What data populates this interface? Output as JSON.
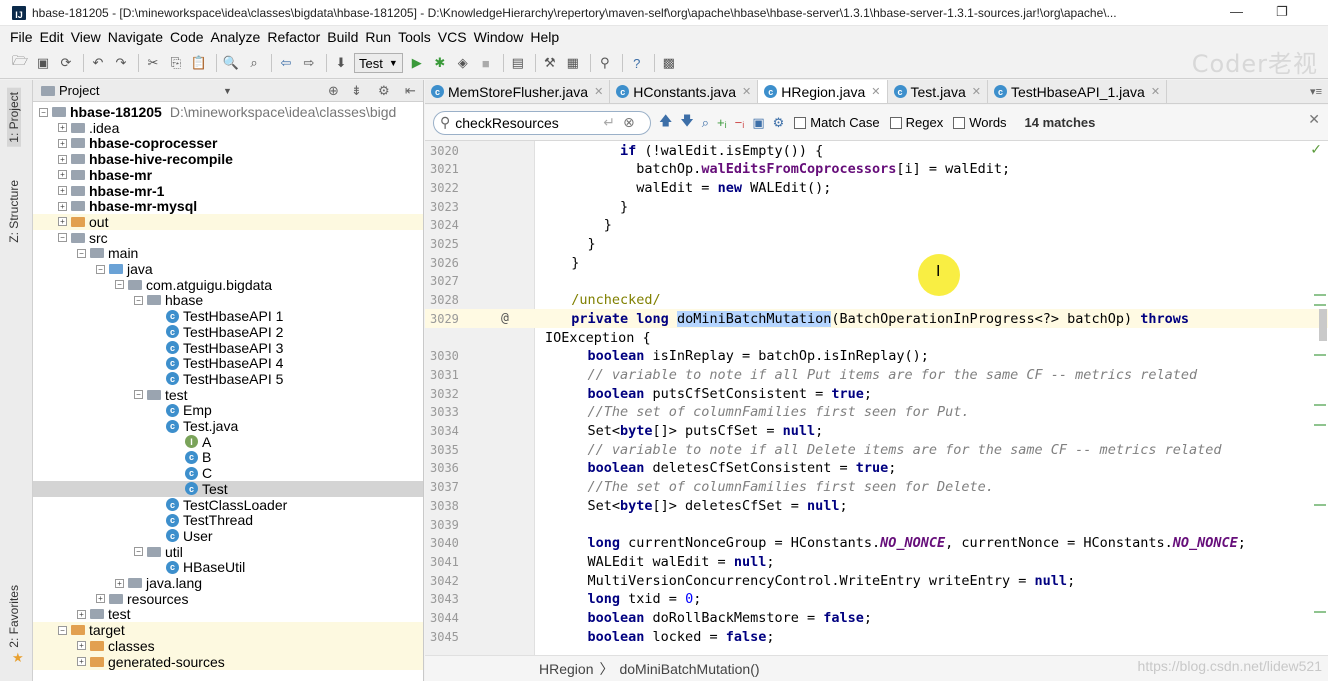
{
  "window": {
    "title": "hbase-181205 - [D:\\mineworkspace\\idea\\classes\\bigdata\\hbase-181205] - D:\\KnowledgeHierarchy\\repertory\\maven-self\\org\\apache\\hbase\\hbase-server\\1.3.1\\hbase-server-1.3.1-sources.jar!\\org\\apache\\...",
    "minimize": "—",
    "restore": "❐"
  },
  "menu": [
    "File",
    "Edit",
    "View",
    "Navigate",
    "Code",
    "Analyze",
    "Refactor",
    "Build",
    "Run",
    "Tools",
    "VCS",
    "Window",
    "Help"
  ],
  "toolbar": {
    "run_config": "Test",
    "watermark": "Coder老视"
  },
  "left_strip": {
    "project_tab": "1: Project",
    "structure_tab": "Z: Structure",
    "favorites_tab": "2: Favorites"
  },
  "project_panel": {
    "title": "Project",
    "tree": [
      {
        "label": "hbase-181205",
        "extra": "D:\\mineworkspace\\idea\\classes\\bigd",
        "indent": 0,
        "icon": "folder",
        "bold": true
      },
      {
        "label": ".idea",
        "indent": 1,
        "icon": "folder"
      },
      {
        "label": "hbase-coprocesser",
        "indent": 1,
        "icon": "folder",
        "bold": true
      },
      {
        "label": "hbase-hive-recompile",
        "indent": 1,
        "icon": "folder",
        "bold": true
      },
      {
        "label": "hbase-mr",
        "indent": 1,
        "icon": "folder",
        "bold": true
      },
      {
        "label": "hbase-mr-1",
        "indent": 1,
        "icon": "folder",
        "bold": true
      },
      {
        "label": "hbase-mr-mysql",
        "indent": 1,
        "icon": "folder",
        "bold": true
      },
      {
        "label": "out",
        "indent": 1,
        "icon": "folder-orange",
        "hl": true
      },
      {
        "label": "src",
        "indent": 1,
        "icon": "folder"
      },
      {
        "label": "main",
        "indent": 2,
        "icon": "folder"
      },
      {
        "label": "java",
        "indent": 3,
        "icon": "folder-blue"
      },
      {
        "label": "com.atguigu.bigdata",
        "indent": 4,
        "icon": "folder"
      },
      {
        "label": "hbase",
        "indent": 5,
        "icon": "folder"
      },
      {
        "label": "TestHbaseAPI 1",
        "indent": 6,
        "icon": "class"
      },
      {
        "label": "TestHbaseAPI 2",
        "indent": 6,
        "icon": "class"
      },
      {
        "label": "TestHbaseAPI 3",
        "indent": 6,
        "icon": "class"
      },
      {
        "label": "TestHbaseAPI 4",
        "indent": 6,
        "icon": "class"
      },
      {
        "label": "TestHbaseAPI 5",
        "indent": 6,
        "icon": "class"
      },
      {
        "label": "test",
        "indent": 5,
        "icon": "folder"
      },
      {
        "label": "Emp",
        "indent": 6,
        "icon": "class"
      },
      {
        "label": "Test.java",
        "indent": 6,
        "icon": "class"
      },
      {
        "label": "A",
        "indent": 7,
        "icon": "class-green"
      },
      {
        "label": "B",
        "indent": 7,
        "icon": "class"
      },
      {
        "label": "C",
        "indent": 7,
        "icon": "class"
      },
      {
        "label": "Test",
        "indent": 7,
        "icon": "class",
        "sel": true
      },
      {
        "label": "TestClassLoader",
        "indent": 6,
        "icon": "class"
      },
      {
        "label": "TestThread",
        "indent": 6,
        "icon": "class"
      },
      {
        "label": "User",
        "indent": 6,
        "icon": "class"
      },
      {
        "label": "util",
        "indent": 5,
        "icon": "folder"
      },
      {
        "label": "HBaseUtil",
        "indent": 6,
        "icon": "class"
      },
      {
        "label": "java.lang",
        "indent": 4,
        "icon": "folder"
      },
      {
        "label": "resources",
        "indent": 3,
        "icon": "folder"
      },
      {
        "label": "test",
        "indent": 2,
        "icon": "folder"
      },
      {
        "label": "target",
        "indent": 1,
        "icon": "folder-orange",
        "hl": true
      },
      {
        "label": "classes",
        "indent": 2,
        "icon": "folder-orange",
        "hl": true
      },
      {
        "label": "generated-sources",
        "indent": 2,
        "icon": "folder-orange",
        "hl": true
      }
    ]
  },
  "tabs": [
    {
      "label": "MemStoreFlusher.java",
      "active": false
    },
    {
      "label": "HConstants.java",
      "active": false
    },
    {
      "label": "HRegion.java",
      "active": true
    },
    {
      "label": "Test.java",
      "active": false
    },
    {
      "label": "TestHbaseAPI_1.java",
      "active": false
    }
  ],
  "search": {
    "query": "checkResources",
    "match_case": "Match Case",
    "regex": "Regex",
    "words": "Words",
    "matches": "14 matches"
  },
  "editor": {
    "lines": [
      {
        "n": "3020",
        "html": "        <span class='kw'>if</span> (!walEdit.isEmpty()) {"
      },
      {
        "n": "3021",
        "html": "          batchOp.<span class='fld'>walEditsFromCoprocessors</span>[i] = walEdit;"
      },
      {
        "n": "3022",
        "html": "          walEdit = <span class='kw'>new</span> WALEdit();"
      },
      {
        "n": "3023",
        "html": "        }"
      },
      {
        "n": "3024",
        "html": "      }"
      },
      {
        "n": "3025",
        "html": "    }"
      },
      {
        "n": "3026",
        "html": "  }"
      },
      {
        "n": "3027",
        "html": ""
      },
      {
        "n": "3028",
        "html": "  <span class='ann'>/unchecked/</span>"
      },
      {
        "n": "3029",
        "html": "  <span class='kw'>private long</span> <span class='hl-word'>doMiniBatchMutation</span>(BatchOperationInProgress&lt;?&gt; batchOp) <span class='kw'>throws</span>",
        "current": true
      },
      {
        "n": "",
        "html": "IOException {",
        "offset": true
      },
      {
        "n": "3030",
        "html": "    <span class='kw'>boolean</span> isInReplay = batchOp.isInReplay();"
      },
      {
        "n": "3031",
        "html": "    <span class='cmt'>// variable to note if all Put items are for the same CF -- metrics related</span>"
      },
      {
        "n": "3032",
        "html": "    <span class='kw'>boolean</span> putsCfSetConsistent = <span class='kw'>true</span>;"
      },
      {
        "n": "3033",
        "html": "    <span class='cmt'>//The set of columnFamilies first seen for Put.</span>"
      },
      {
        "n": "3034",
        "html": "    Set&lt;<span class='kw'>byte</span>[]&gt; putsCfSet = <span class='kw'>null</span>;"
      },
      {
        "n": "3035",
        "html": "    <span class='cmt'>// variable to note if all Delete items are for the same CF -- metrics related</span>"
      },
      {
        "n": "3036",
        "html": "    <span class='kw'>boolean</span> deletesCfSetConsistent = <span class='kw'>true</span>;"
      },
      {
        "n": "3037",
        "html": "    <span class='cmt'>//The set of columnFamilies first seen for Delete.</span>"
      },
      {
        "n": "3038",
        "html": "    Set&lt;<span class='kw'>byte</span>[]&gt; deletesCfSet = <span class='kw'>null</span>;"
      },
      {
        "n": "3039",
        "html": ""
      },
      {
        "n": "3040",
        "html": "    <span class='kw'>long</span> currentNonceGroup = HConstants.<span class='cst'>NO_NONCE</span>, currentNonce = HConstants.<span class='cst'>NO_NONCE</span>;"
      },
      {
        "n": "3041",
        "html": "    WALEdit walEdit = <span class='kw'>null</span>;"
      },
      {
        "n": "3042",
        "html": "    MultiVersionConcurrencyControl.WriteEntry writeEntry = <span class='kw'>null</span>;"
      },
      {
        "n": "3043",
        "html": "    <span class='kw'>long</span> txid = <span class='num'>0</span>;"
      },
      {
        "n": "3044",
        "html": "    <span class='kw'>boolean</span> doRollBackMemstore = <span class='kw'>false</span>;"
      },
      {
        "n": "3045",
        "html": "    <span class='kw'>boolean</span> locked = <span class='kw'>false</span>;"
      }
    ]
  },
  "breadcrumb": [
    "HRegion",
    "doMiniBatchMutation()"
  ],
  "watermark_bottom": "https://blog.csdn.net/lidew521"
}
